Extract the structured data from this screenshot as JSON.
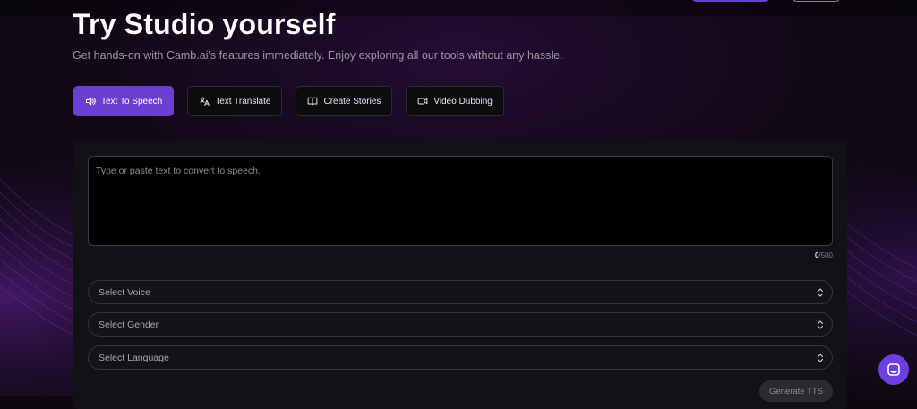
{
  "hero": {
    "title": "Try Studio yourself",
    "subtitle": "Get hands-on with Camb.ai's features immediately. Enjoy exploring all our tools without any hassle."
  },
  "tabs": [
    {
      "label": "Text To Speech",
      "icon": "speaker-icon",
      "active": true
    },
    {
      "label": "Text Translate",
      "icon": "translate-icon",
      "active": false
    },
    {
      "label": "Create Stories",
      "icon": "book-icon",
      "active": false
    },
    {
      "label": "Video Dubbing",
      "icon": "video-icon",
      "active": false
    }
  ],
  "tts": {
    "text_placeholder": "Type or paste text to convert to speech.",
    "char_count": "0",
    "char_limit": "/500",
    "voice_placeholder": "Select Voice",
    "gender_placeholder": "Select Gender",
    "language_placeholder": "Select Language",
    "generate_label": "Generate TTS"
  },
  "colors": {
    "accent": "#6a3fd1",
    "background": "#0d0810",
    "panel": "#121216"
  }
}
